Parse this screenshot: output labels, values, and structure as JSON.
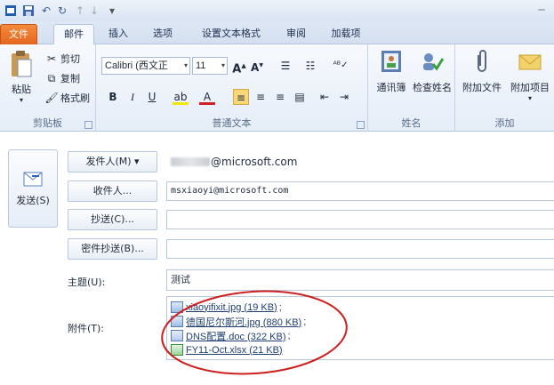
{
  "qat": {
    "icons": [
      "outlook-app-icon",
      "save-icon",
      "undo-icon",
      "redo-icon",
      "up-arrow-icon",
      "down-arrow-icon",
      "customize-icon"
    ]
  },
  "tabs": [
    {
      "label": "文件",
      "kind": "file"
    },
    {
      "label": "邮件",
      "kind": "active"
    },
    {
      "label": "插入",
      "kind": ""
    },
    {
      "label": "选项",
      "kind": ""
    },
    {
      "label": "设置文本格式",
      "kind": ""
    },
    {
      "label": "审阅",
      "kind": ""
    },
    {
      "label": "加载项",
      "kind": ""
    }
  ],
  "ribbon": {
    "clipboard": {
      "paste": "粘贴",
      "cut": "剪切",
      "copy": "复制",
      "format_painter": "格式刷",
      "label": "剪贴板"
    },
    "basic_text": {
      "font": "Calibri (西文正",
      "size": "11",
      "label": "普通文本"
    },
    "names": {
      "address_book": "通讯簿",
      "check_names": "检查姓名",
      "label": "姓名"
    },
    "include": {
      "attach_file": "附加文件",
      "attach_item": "附加项目",
      "label": "添加"
    }
  },
  "compose": {
    "send": "发送(S)",
    "from_button": "发件人(M) ▾",
    "from_value": "@microsoft.com",
    "to_button": "收件人...",
    "to_value": "msxiaoyi@microsoft.com",
    "cc_button": "抄送(C)...",
    "cc_value": "",
    "bcc_button": "密件抄送(B)...",
    "bcc_value": "",
    "subject_label": "主题(U):",
    "subject_value": "测试",
    "attachments_label": "附件(T):",
    "attachments": [
      {
        "name": "xiaoyifixit.jpg (19 KB)",
        "sep": ";",
        "icon": "image-file-icon"
      },
      {
        "name": "德国尼尔斯河.jpg (880 KB)",
        "sep": ";",
        "icon": "image-file-icon"
      },
      {
        "name": "DNS配置.doc (322 KB)",
        "sep": ";",
        "icon": "word-doc-icon"
      },
      {
        "name": "FY11-Oct.xlsx (21 KB)",
        "sep": "",
        "icon": "excel-file-icon"
      }
    ]
  },
  "colors": {
    "file_tab": "#e3661e",
    "highlight_circle": "#cc2020",
    "ribbon_bg": "#e5edf8"
  }
}
